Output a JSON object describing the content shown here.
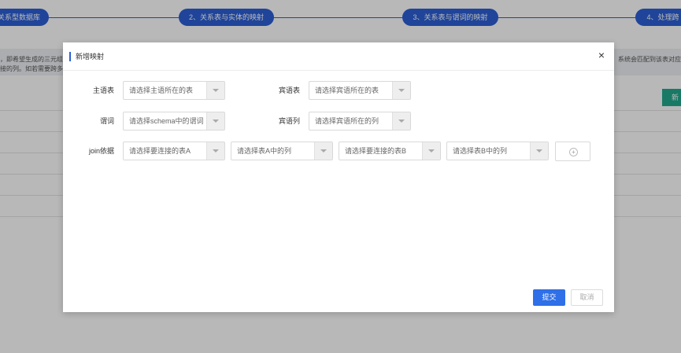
{
  "background": {
    "steps": [
      {
        "label": "关系型数据库"
      },
      {
        "label": "2、关系表与实体的映射"
      },
      {
        "label": "3、关系表与谓词的映射"
      },
      {
        "label": "4、处理跨"
      }
    ],
    "note_left_1": "，即希望生成的三元组",
    "note_left_2": "接的列。如若需要跨多",
    "note_right": "系统会匹配到该表对应",
    "new_button": "新"
  },
  "modal": {
    "title": "新增映射",
    "close_icon": "×",
    "fields": {
      "subject_table": {
        "label": "主语表",
        "placeholder": "请选择主语所在的表"
      },
      "object_table": {
        "label": "宾语表",
        "placeholder": "请选择宾语所在的表"
      },
      "predicate": {
        "label": "谓词",
        "placeholder": "请选择schema中的谓词"
      },
      "object_column": {
        "label": "宾语列",
        "placeholder": "请选择宾语所在的列"
      },
      "join": {
        "label": "join依据",
        "table_a": "请选择要连接的表A",
        "column_a": "请选择表A中的列",
        "table_b": "请选择要连接的表B",
        "column_b": "请选择表B中的列"
      }
    },
    "add_icon": "+",
    "submit_label": "提交",
    "cancel_label": "取消"
  },
  "colors": {
    "primary": "#2f6fe8",
    "step": "#2b5fd6",
    "accent_green": "#22a98c"
  }
}
